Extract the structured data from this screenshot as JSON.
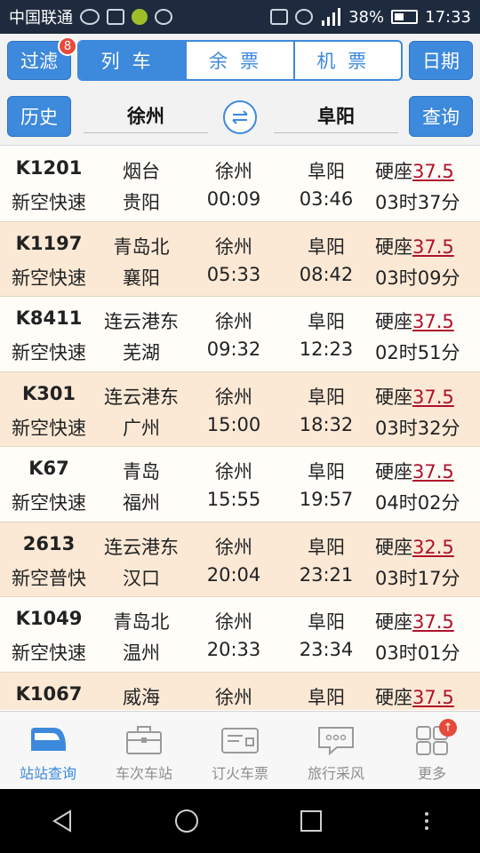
{
  "status_bar": {
    "carrier": "中国联通",
    "battery": "38%",
    "time": "17:33"
  },
  "toolbar": {
    "filter_label": "过滤",
    "filter_badge": "8",
    "tabs": [
      {
        "label": "列车",
        "active": true
      },
      {
        "label": "余票",
        "active": false
      },
      {
        "label": "机票",
        "active": false
      }
    ],
    "date_label": "日期"
  },
  "search": {
    "history_label": "历史",
    "from_station": "徐州",
    "to_station": "阜阳",
    "query_label": "查询"
  },
  "trains": [
    {
      "code": "K1201",
      "type": "新空快速",
      "origin": "烟台",
      "terminus": "贵阳",
      "board": "徐州",
      "depart": "00:09",
      "arrive_station": "阜阳",
      "arrive": "03:46",
      "seat": "硬座",
      "price": "37.5",
      "duration": "03时37分"
    },
    {
      "code": "K1197",
      "type": "新空快速",
      "origin": "青岛北",
      "terminus": "襄阳",
      "board": "徐州",
      "depart": "05:33",
      "arrive_station": "阜阳",
      "arrive": "08:42",
      "seat": "硬座",
      "price": "37.5",
      "duration": "03时09分"
    },
    {
      "code": "K8411",
      "type": "新空快速",
      "origin": "连云港东",
      "terminus": "芜湖",
      "board": "徐州",
      "depart": "09:32",
      "arrive_station": "阜阳",
      "arrive": "12:23",
      "seat": "硬座",
      "price": "37.5",
      "duration": "02时51分"
    },
    {
      "code": "K301",
      "type": "新空快速",
      "origin": "连云港东",
      "terminus": "广州",
      "board": "徐州",
      "depart": "15:00",
      "arrive_station": "阜阳",
      "arrive": "18:32",
      "seat": "硬座",
      "price": "37.5",
      "duration": "03时32分"
    },
    {
      "code": "K67",
      "type": "新空快速",
      "origin": "青岛",
      "terminus": "福州",
      "board": "徐州",
      "depart": "15:55",
      "arrive_station": "阜阳",
      "arrive": "19:57",
      "seat": "硬座",
      "price": "37.5",
      "duration": "04时02分"
    },
    {
      "code": "2613",
      "type": "新空普快",
      "origin": "连云港东",
      "terminus": "汉口",
      "board": "徐州",
      "depart": "20:04",
      "arrive_station": "阜阳",
      "arrive": "23:21",
      "seat": "硬座",
      "price": "32.5",
      "duration": "03时17分"
    },
    {
      "code": "K1049",
      "type": "新空快速",
      "origin": "青岛北",
      "terminus": "温州",
      "board": "徐州",
      "depart": "20:33",
      "arrive_station": "阜阳",
      "arrive": "23:34",
      "seat": "硬座",
      "price": "37.5",
      "duration": "03时01分"
    },
    {
      "code": "K1067",
      "type": "",
      "origin": "威海",
      "terminus": "",
      "board": "徐州",
      "depart": "",
      "arrive_station": "阜阳",
      "arrive": "",
      "seat": "硬座",
      "price": "37.5",
      "duration": ""
    }
  ],
  "bottom_nav": [
    {
      "label": "站站查询",
      "icon": "train-icon",
      "active": true
    },
    {
      "label": "车次车站",
      "icon": "briefcase-icon",
      "active": false
    },
    {
      "label": "订火车票",
      "icon": "ticket-icon",
      "active": false
    },
    {
      "label": "旅行采风",
      "icon": "chat-bubble-icon",
      "active": false
    },
    {
      "label": "更多",
      "icon": "grid-icon",
      "active": false,
      "badge": "↑"
    }
  ],
  "colors": {
    "accent": "#3d89dc",
    "price": "#b0112a",
    "row_alt": "#fbe9d6",
    "status_bar": "#1e2b3f"
  }
}
